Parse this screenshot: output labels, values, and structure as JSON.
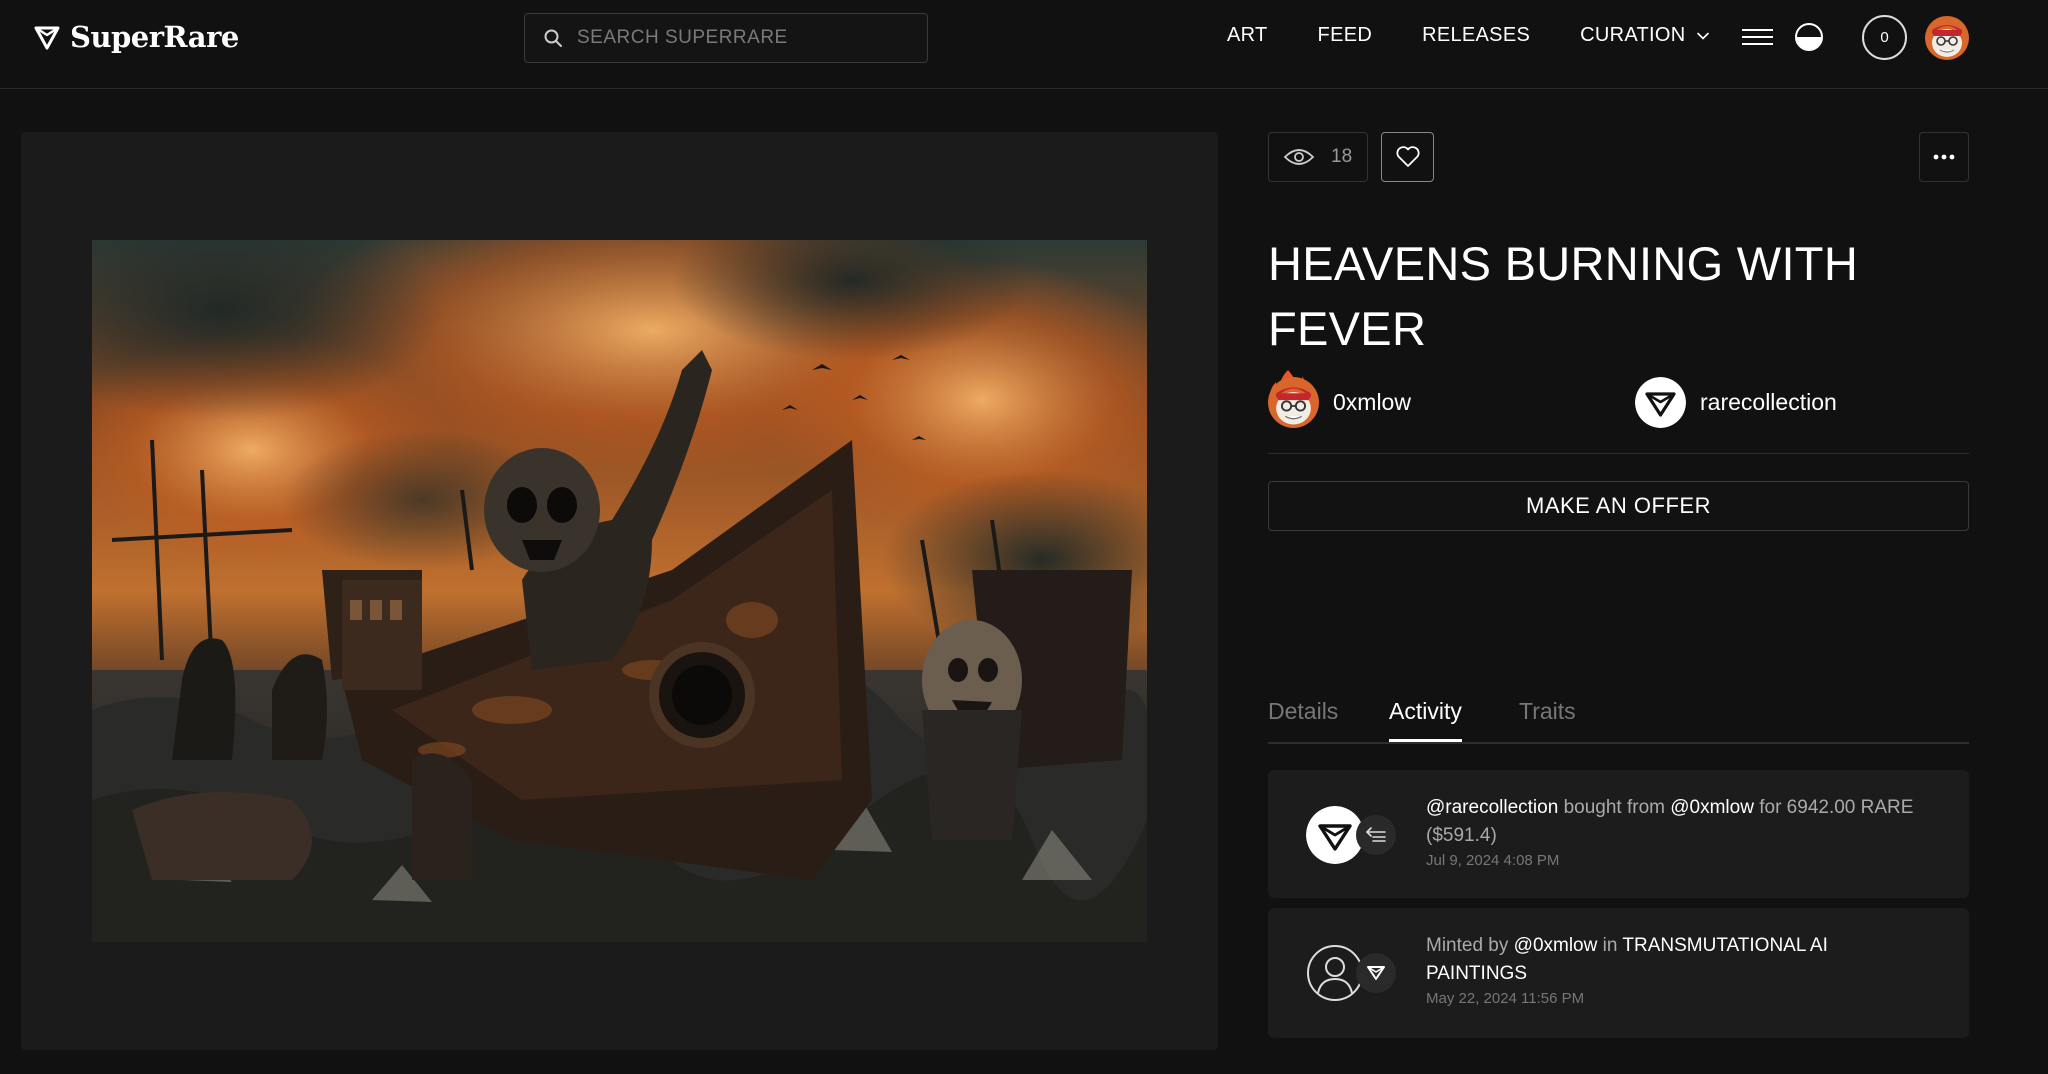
{
  "header": {
    "logo_text": "SuperRare",
    "search_placeholder": "SEARCH SUPERRARE",
    "nav": [
      "ART",
      "FEED",
      "RELEASES",
      "CURATION"
    ],
    "cart_count": "0"
  },
  "artwork": {
    "view_count": "18",
    "title": "HEAVENS BURNING WITH FEVER"
  },
  "people": {
    "artist": "0xmlow",
    "owner": "rarecollection"
  },
  "actions": {
    "offer_label": "MAKE AN OFFER"
  },
  "tabs": [
    "Details",
    "Activity",
    "Traits"
  ],
  "active_tab": "Activity",
  "activity": [
    {
      "actor": "@rarecollection",
      "verb": " bought from ",
      "target": "@0xmlow",
      "suffix": " for 6942.00 RARE ($591.4)",
      "time": "Jul 9, 2024 4:08 PM"
    },
    {
      "prefix": "Minted by ",
      "actor": "@0xmlow",
      "mid": " in ",
      "collection": "TRANSMUTATIONAL AI PAINTINGS",
      "time": "May 22, 2024 11:56 PM"
    }
  ],
  "colors": {
    "background": "#111111",
    "panel": "#1b1b1b",
    "card": "#1c1c1c",
    "border": "#3a3a3a",
    "muted_text": "#aaaaaa"
  },
  "icons": [
    "superrare-logo-icon",
    "search-icon",
    "chevron-down-icon",
    "menu-icon",
    "theme-toggle-icon",
    "eye-icon",
    "heart-icon",
    "more-icon",
    "fire-icon",
    "transfer-icon",
    "user-icon"
  ]
}
